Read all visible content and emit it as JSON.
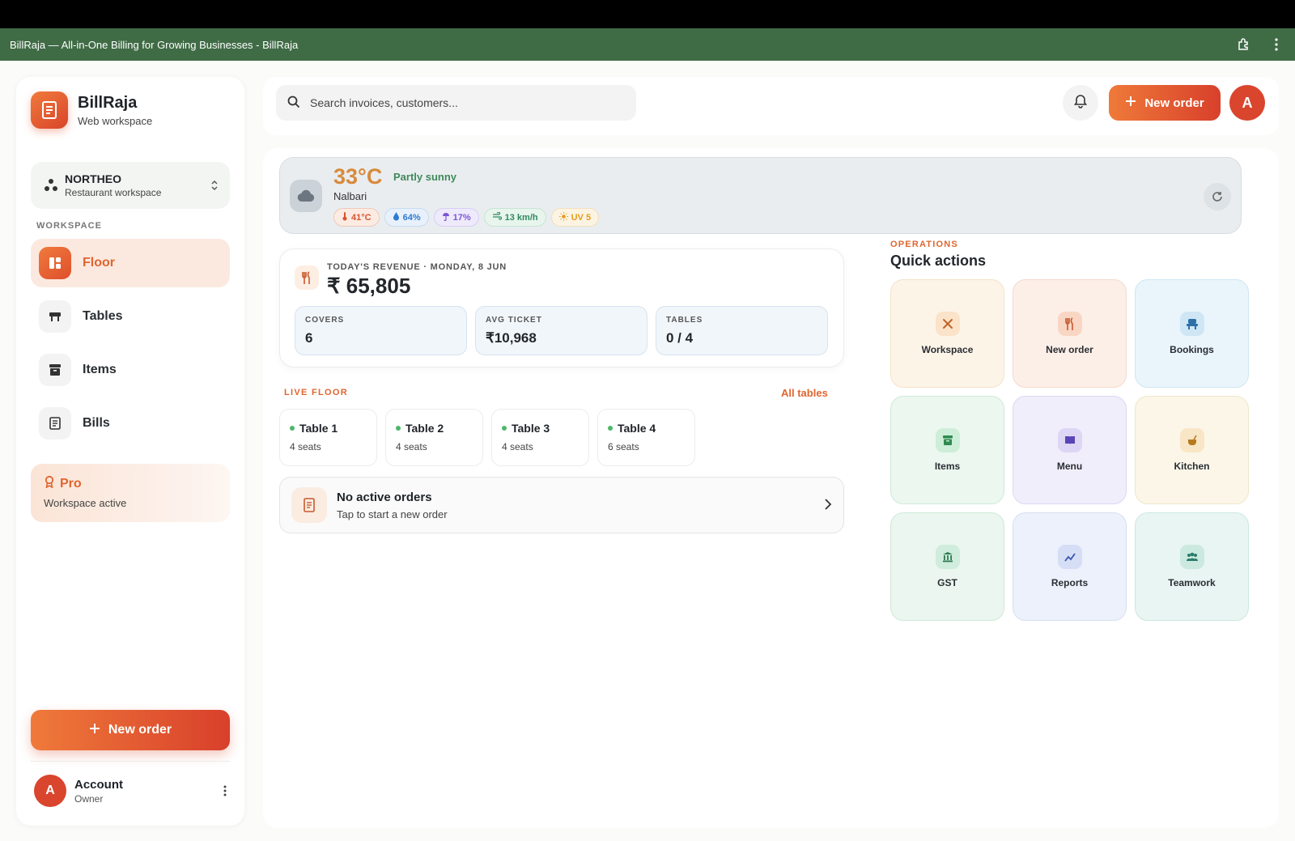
{
  "window": {
    "title": "BillRaja — All-in-One Billing for Growing Businesses - BillRaja",
    "icons": [
      "extension-icon",
      "more-vertical-icon"
    ]
  },
  "brand": {
    "name": "BillRaja",
    "subtitle": "Web workspace"
  },
  "workspace": {
    "name": "NORTHEO",
    "type": "Restaurant workspace"
  },
  "sidebar": {
    "section_label": "WORKSPACE",
    "items": [
      {
        "label": "Floor",
        "icon": "floor-grid-icon",
        "active": true
      },
      {
        "label": "Tables",
        "icon": "table-icon",
        "active": false
      },
      {
        "label": "Items",
        "icon": "archive-icon",
        "active": false
      },
      {
        "label": "Bills",
        "icon": "receipt-icon",
        "active": false
      }
    ],
    "pro": {
      "title": "Pro",
      "subtitle": "Workspace active"
    },
    "new_order_label": "New order",
    "account": {
      "initial": "A",
      "name": "Account",
      "role": "Owner"
    }
  },
  "header": {
    "search_placeholder": "Search invoices, customers...",
    "new_order_label": "New order",
    "avatar_initial": "A"
  },
  "weather": {
    "temperature": "33°C",
    "condition": "Partly sunny",
    "location": "Nalbari",
    "chips": [
      {
        "label": "41°C",
        "icon": "thermometer-icon",
        "color": "#d9542e"
      },
      {
        "label": "64%",
        "icon": "droplet-icon",
        "color": "#2e7ad1"
      },
      {
        "label": "17%",
        "icon": "umbrella-icon",
        "color": "#7b55d6"
      },
      {
        "label": "13 km/h",
        "icon": "wind-icon",
        "color": "#2f8a5f"
      },
      {
        "label": "UV 5",
        "icon": "sun-icon",
        "color": "#e39a1f"
      }
    ]
  },
  "revenue": {
    "label": "TODAY'S REVENUE · MONDAY, 8 JUN",
    "value": "₹ 65,805",
    "stats": [
      {
        "label": "COVERS",
        "value": "6"
      },
      {
        "label": "AVG TICKET",
        "value": "₹10,968"
      },
      {
        "label": "TABLES",
        "value": "0 / 4"
      }
    ]
  },
  "live_floor": {
    "label": "LIVE FLOOR",
    "all_tables_label": "All tables",
    "tables": [
      {
        "name": "Table 1",
        "seats": "4 seats"
      },
      {
        "name": "Table 2",
        "seats": "4 seats"
      },
      {
        "name": "Table 3",
        "seats": "4 seats"
      },
      {
        "name": "Table 4",
        "seats": "6 seats"
      }
    ],
    "empty_state": {
      "title": "No active orders",
      "subtitle": "Tap to start a new order"
    }
  },
  "operations": {
    "label": "OPERATIONS",
    "title": "Quick actions",
    "actions": [
      {
        "label": "Workspace",
        "icon": "tools-icon",
        "bg": "#fdf4e8",
        "border": "#f5e2c8",
        "icon_bg": "#fbe3c9",
        "icon_color": "#c0652a"
      },
      {
        "label": "New order",
        "icon": "utensils-icon",
        "bg": "#fcefe8",
        "border": "#f5d9cb",
        "icon_bg": "#f9d6c4",
        "icon_color": "#c75a2e"
      },
      {
        "label": "Bookings",
        "icon": "chair-icon",
        "bg": "#eaf5fb",
        "border": "#cfe6f2",
        "icon_bg": "#cfe6f5",
        "icon_color": "#2e6fa8"
      },
      {
        "label": "Items",
        "icon": "archive-icon",
        "bg": "#ebf7ef",
        "border": "#cfeadb",
        "icon_bg": "#cdeed9",
        "icon_color": "#2f8a4f"
      },
      {
        "label": "Menu",
        "icon": "book-icon",
        "bg": "#f1eefb",
        "border": "#ddd7f3",
        "icon_bg": "#ddd6f5",
        "icon_color": "#5a45b5"
      },
      {
        "label": "Kitchen",
        "icon": "cooking-pot-icon",
        "bg": "#fcf6e9",
        "border": "#f1e6cb",
        "icon_bg": "#f8e6c6",
        "icon_color": "#b8791f"
      },
      {
        "label": "GST",
        "icon": "bank-icon",
        "bg": "#eaf6ef",
        "border": "#cfe9da",
        "icon_bg": "#cfecdc",
        "icon_color": "#2e7a52"
      },
      {
        "label": "Reports",
        "icon": "trend-chart-icon",
        "bg": "#edf1fb",
        "border": "#d6def2",
        "icon_bg": "#d5def5",
        "icon_color": "#3a55b0"
      },
      {
        "label": "Teamwork",
        "icon": "users-icon",
        "bg": "#e9f5f2",
        "border": "#cce8e0",
        "icon_bg": "#cbe9df",
        "icon_color": "#2a7a69"
      }
    ]
  }
}
